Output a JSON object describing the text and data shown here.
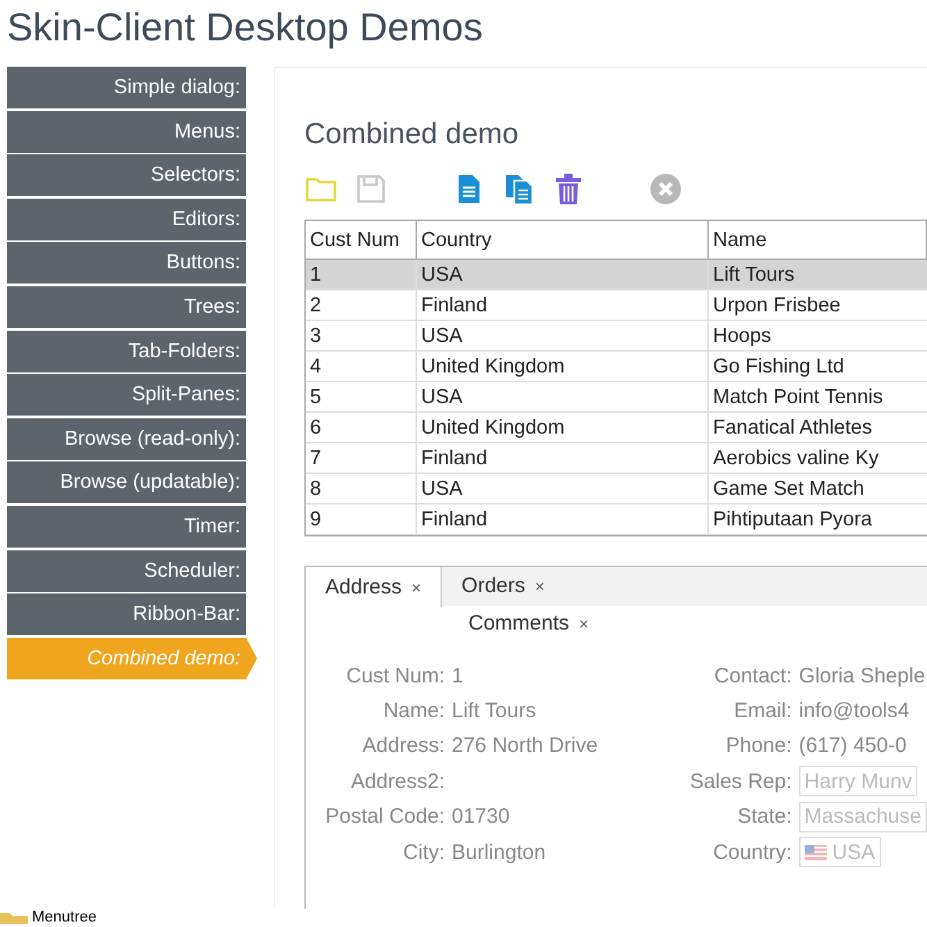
{
  "title": "Skin-Client Desktop Demos",
  "sidebar": {
    "items": [
      {
        "label": "Simple dialog:",
        "selected": false
      },
      {
        "label": "Menus:",
        "selected": false
      },
      {
        "label": "Selectors:",
        "selected": false
      },
      {
        "label": "Editors:",
        "selected": false
      },
      {
        "label": "Buttons:",
        "selected": false
      },
      {
        "label": "Trees:",
        "selected": false
      },
      {
        "label": "Tab-Folders:",
        "selected": false
      },
      {
        "label": "Split-Panes:",
        "selected": false
      },
      {
        "label": "Browse (read-only):",
        "selected": false
      },
      {
        "label": "Browse (updatable):",
        "selected": false
      },
      {
        "label": "Timer:",
        "selected": false
      },
      {
        "label": "Scheduler:",
        "selected": false
      },
      {
        "label": "Ribbon-Bar:",
        "selected": false
      },
      {
        "label": "Combined demo:",
        "selected": true
      }
    ]
  },
  "panel": {
    "heading": "Combined demo",
    "table": {
      "columns": [
        "Cust Num",
        "Country",
        "Name"
      ],
      "rows": [
        {
          "cells": [
            "1",
            "USA",
            "Lift Tours"
          ],
          "selected": true
        },
        {
          "cells": [
            "2",
            "Finland",
            "Urpon Frisbee"
          ],
          "selected": false
        },
        {
          "cells": [
            "3",
            "USA",
            "Hoops"
          ],
          "selected": false
        },
        {
          "cells": [
            "4",
            "United Kingdom",
            "Go Fishing Ltd"
          ],
          "selected": false
        },
        {
          "cells": [
            "5",
            "USA",
            "Match Point Tennis"
          ],
          "selected": false
        },
        {
          "cells": [
            "6",
            "United Kingdom",
            "Fanatical Athletes"
          ],
          "selected": false
        },
        {
          "cells": [
            "7",
            "Finland",
            "Aerobics valine Ky"
          ],
          "selected": false
        },
        {
          "cells": [
            "8",
            "USA",
            "Game Set Match"
          ],
          "selected": false
        },
        {
          "cells": [
            "9",
            "Finland",
            "Pihtiputaan Pyora"
          ],
          "selected": false
        }
      ]
    },
    "tabs": [
      {
        "label": "Address",
        "close": "×",
        "selected": true
      },
      {
        "label": "Orders",
        "close": "×",
        "selected": false
      },
      {
        "label": "Comments",
        "close": "×",
        "selected": false
      }
    ],
    "form": {
      "left": [
        {
          "label": "Cust Num:",
          "value": "1"
        },
        {
          "label": "Name:",
          "value": "Lift Tours"
        },
        {
          "label": "Address:",
          "value": "276 North Drive"
        },
        {
          "label": "Address2:"
        },
        {
          "label": "Postal Code:",
          "value": "01730"
        },
        {
          "label": "City:",
          "value": "Burlington"
        }
      ],
      "right": [
        {
          "label": "Contact:",
          "value": "Gloria Sheple",
          "kind": "text"
        },
        {
          "label": "Email:",
          "value": "info@tools4",
          "kind": "text"
        },
        {
          "label": "Phone:",
          "value": "(617) 450-0",
          "kind": "text"
        },
        {
          "label": "Sales Rep:",
          "value": "Harry Munv",
          "kind": "field"
        },
        {
          "label": "State:",
          "value": "Massachuse",
          "kind": "field"
        },
        {
          "label": "Country:",
          "value": "USA",
          "kind": "flagfield"
        }
      ]
    }
  },
  "footer": {
    "label": "Menutree"
  }
}
